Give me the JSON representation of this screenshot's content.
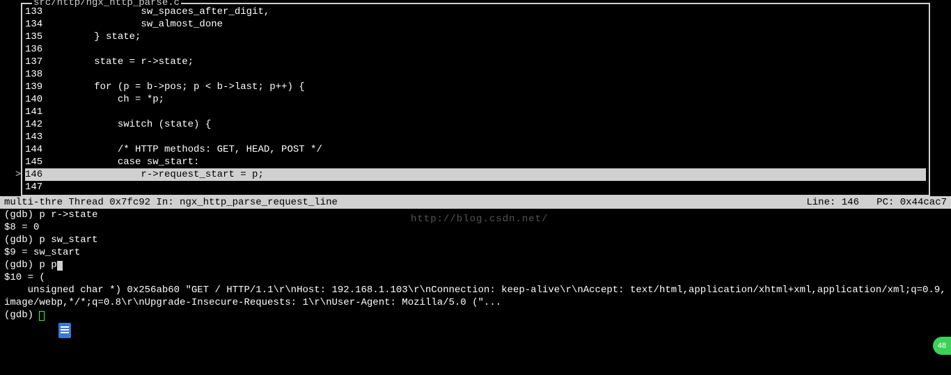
{
  "source": {
    "filename": "src/http/ngx_http_parse.c",
    "current_marker": ">",
    "lines": [
      {
        "num": "133",
        "text": "                sw_spaces_after_digit,",
        "current": false
      },
      {
        "num": "134",
        "text": "                sw_almost_done",
        "current": false
      },
      {
        "num": "135",
        "text": "        } state;",
        "current": false
      },
      {
        "num": "136",
        "text": "",
        "current": false
      },
      {
        "num": "137",
        "text": "        state = r->state;",
        "current": false
      },
      {
        "num": "138",
        "text": "",
        "current": false
      },
      {
        "num": "139",
        "text": "        for (p = b->pos; p < b->last; p++) {",
        "current": false
      },
      {
        "num": "140",
        "text": "            ch = *p;",
        "current": false
      },
      {
        "num": "141",
        "text": "",
        "current": false
      },
      {
        "num": "142",
        "text": "            switch (state) {",
        "current": false
      },
      {
        "num": "143",
        "text": "",
        "current": false
      },
      {
        "num": "144",
        "text": "            /* HTTP methods: GET, HEAD, POST */",
        "current": false
      },
      {
        "num": "145",
        "text": "            case sw_start:",
        "current": false
      },
      {
        "num": "146",
        "text": "                r->request_start = p;",
        "current": true
      },
      {
        "num": "147",
        "text": "",
        "current": false
      }
    ]
  },
  "status": {
    "left": "multi-thre Thread 0x7fc92 In: ngx_http_parse_request_line",
    "right": "Line: 146   PC: 0x44cac7"
  },
  "gdb": {
    "lines": [
      "(gdb) p r->state",
      "$8 = 0",
      "(gdb) p sw_start",
      "$9 = sw_start",
      "(gdb) p p",
      "$10 = (",
      "    unsigned char *) 0x256ab60 \"GET / HTTP/1.1\\r\\nHost: 192.168.1.103\\r\\nConnection: keep-alive\\r\\nAccept: text/html,application/xhtml+xml,application/xml;q=0.9,image/webp,*/*;q=0.8\\r\\nUpgrade-Insecure-Requests: 1\\r\\nUser-Agent: Mozilla/5.0 (\"...",
      "(gdb) "
    ],
    "caret_line_index": 4,
    "prompt_cursor_line_index": 7
  },
  "watermark": "http://blog.csdn.net/",
  "badge": "48"
}
